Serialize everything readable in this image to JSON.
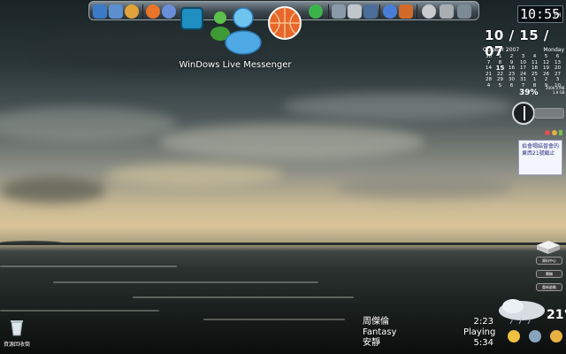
{
  "clock": {
    "time": "10:55",
    "ampm": "PM"
  },
  "date": {
    "big": "10 / 15 / 07"
  },
  "calendar": {
    "month": "October 2007",
    "weekday": "Monday",
    "days": [
      "30",
      "1",
      "2",
      "3",
      "4",
      "5",
      "6",
      "7",
      "8",
      "9",
      "10",
      "11",
      "12",
      "13",
      "14",
      "15",
      "16",
      "17",
      "18",
      "19",
      "20",
      "21",
      "22",
      "23",
      "24",
      "25",
      "26",
      "27",
      "28",
      "29",
      "30",
      "31",
      "1",
      "2",
      "3",
      "4",
      "5",
      "6",
      "7",
      "8",
      "9",
      "10"
    ],
    "today": "15"
  },
  "cpu": {
    "percent": "39%",
    "mem1": "2000.0 MB",
    "mem2": "1.9 GB"
  },
  "dock": {
    "app_label": "WinDows Live Messenger"
  },
  "note": {
    "text": "抬會喝結晉會的東西21號截止"
  },
  "buttons": {
    "b1": "資料中心",
    "b2": "關機",
    "b3": "重新啟動"
  },
  "media": {
    "artist": "周傑倫",
    "album": "Fantasy",
    "title": "安靜",
    "elapsed": "2:23",
    "status": "Playing",
    "total": "5:34"
  },
  "weather": {
    "temp": "21°"
  },
  "recycle_bin": {
    "label": "資源回收筒"
  },
  "colors": {
    "dock_accent": "#3d474e",
    "sky_gold": "#d8c497"
  }
}
